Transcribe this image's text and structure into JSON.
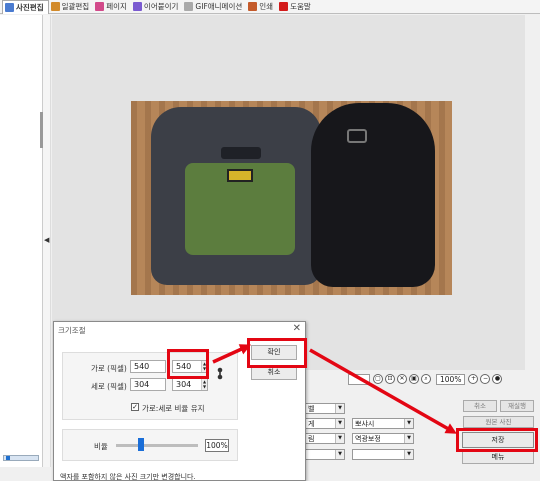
{
  "tabs": [
    {
      "label": "사진편집",
      "icon": "photo-edit-icon",
      "color": "#4a7bd0",
      "active": true
    },
    {
      "label": "일괄편집",
      "icon": "batch-edit-icon",
      "color": "#d28a2a",
      "active": false
    },
    {
      "label": "페이지",
      "icon": "page-icon",
      "color": "#d24a8a",
      "active": false
    },
    {
      "label": "이어붙이기",
      "icon": "merge-icon",
      "color": "#7a5ad0",
      "active": false
    },
    {
      "label": "GIF애니메이션",
      "icon": "gif-icon",
      "color": "#aaaaaa",
      "active": false
    },
    {
      "label": "인쇄",
      "icon": "print-icon",
      "color": "#c45a2a",
      "active": false
    },
    {
      "label": "도움말",
      "icon": "help-icon",
      "color": "#d31a1a",
      "active": false
    }
  ],
  "toolbar": {
    "zoom_value": "100%"
  },
  "options": {
    "select1": "벨",
    "select2": "게",
    "select3": "뽀샤시",
    "select4": "림",
    "select5": "역광보정"
  },
  "side_buttons": {
    "cancel": "취소",
    "redo": "재실행",
    "original": "원본 사진",
    "save": "저장",
    "menu": "메뉴"
  },
  "dialog": {
    "title": "크기조절",
    "width_label": "가로 (픽셀)",
    "height_label": "세로 (픽셀)",
    "orig_width": "540",
    "orig_height": "304",
    "new_width": "540",
    "new_height": "304",
    "keep_ratio_label": "가로:세로 비율 유지",
    "keep_ratio_checked": true,
    "ratio_label": "비율",
    "ratio_value": "100%",
    "ratio_fraction": 0.3,
    "hint": "액자를 포함하지 않은 사진 크기만 변경합니다.",
    "ok_label": "확인",
    "cancel_label": "취소"
  },
  "colors": {
    "annotation_red": "#e30613",
    "slider_blue": "#1a6ed8"
  }
}
